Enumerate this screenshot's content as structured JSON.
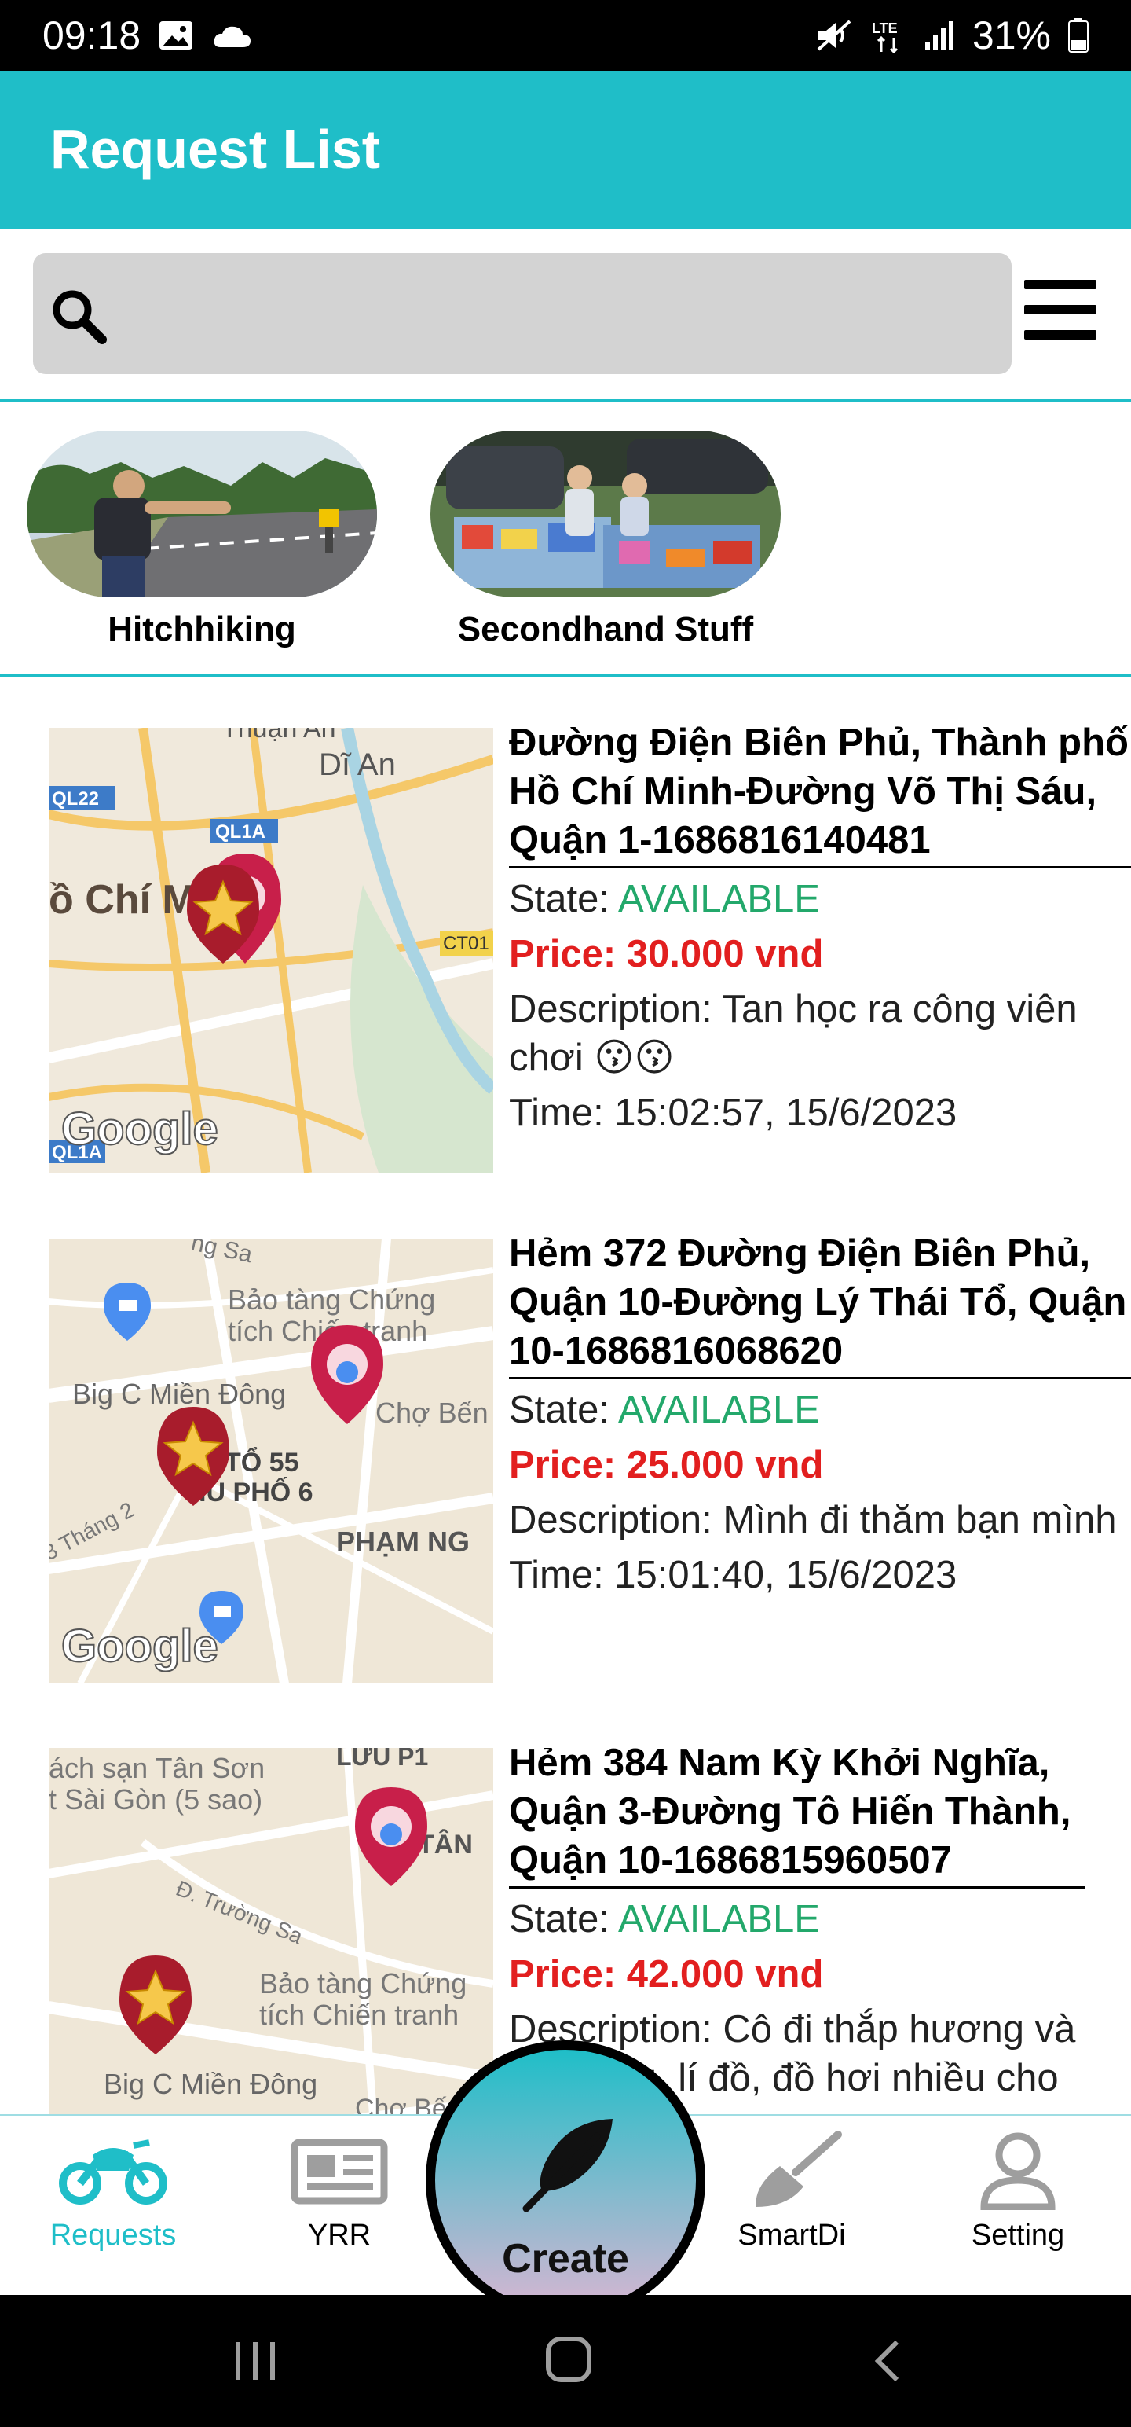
{
  "status_bar": {
    "time": "09:18",
    "battery": "31%",
    "network": "LTE"
  },
  "app_bar": {
    "title": "Request List"
  },
  "search": {
    "placeholder": ""
  },
  "categories": [
    {
      "label": "Hitchhiking"
    },
    {
      "label": "Secondhand Stuff"
    }
  ],
  "requests": [
    {
      "title": "Đường Điện Biên Phủ, Thành phố Hồ Chí Minh-Đường Võ Thị Sáu, Quận 1-1686816140481",
      "state_label": "State: ",
      "state_value": "AVAILABLE",
      "price": "Price: 30.000 vnd",
      "description": "Description: Tan học ra công viên chơi 😗😗",
      "time": "Time: 15:02:57, 15/6/2023",
      "map_labels": [
        "Thuận An",
        "Dĩ An",
        "QL22",
        "QL1A",
        "ồ Chí Mi",
        "CT01",
        "Google",
        "QL1A"
      ]
    },
    {
      "title": "Hẻm 372 Đường Điện Biên Phủ, Quận 10-Đường Lý Thái Tổ, Quận 10-1686816068620",
      "state_label": "State: ",
      "state_value": "AVAILABLE",
      "price": "Price: 25.000 vnd",
      "description": "Description: Mình đi thăm bạn mình",
      "time": "Time: 15:01:40, 15/6/2023",
      "map_labels": [
        "ng Sa",
        "Bảo tàng Chứng",
        "tích Chiến tranh",
        "Big C Miền Đông",
        "Chợ Bến Th",
        "TỔ 55",
        "HU PHỐ 6",
        "3 Tháng 2",
        "PHẠM NG",
        "Google"
      ]
    },
    {
      "title": "Hẻm 384 Nam Kỳ Khởi Nghĩa, Quận 3-Đường Tô Hiến Thành, Quận 10-1686815960507",
      "state_label": "State: ",
      "state_value": "AVAILABLE",
      "price": "Price: 42.000 vnd",
      "description": "Description: Cô đi thắp hương và lo vật dụng, lí đồ, đồ hơi nhiều cho",
      "time": "",
      "map_labels": [
        "ách sạn Tân Sơn",
        "t Sài Gòn (5 sao)",
        "LƯU P1",
        "TÂN",
        "Đ. Trường Sa",
        "Bảo tàng Chứng",
        "tích Chiến tranh",
        "Big C Miền Đông",
        "Chợ Bến"
      ]
    }
  ],
  "bottom_nav": {
    "items": [
      {
        "label": "Requests",
        "icon": "motorbike-icon",
        "active": true
      },
      {
        "label": "YRR",
        "icon": "newspaper-icon",
        "active": false
      },
      {
        "label": "SmartDi",
        "icon": "broom-icon",
        "active": false
      },
      {
        "label": "Setting",
        "icon": "person-icon",
        "active": false
      }
    ],
    "create_label": "Create"
  },
  "colors": {
    "accent": "#1fbec8",
    "available": "#23a86b",
    "price": "#e21f1f",
    "search_bg": "#d3d3d3"
  }
}
